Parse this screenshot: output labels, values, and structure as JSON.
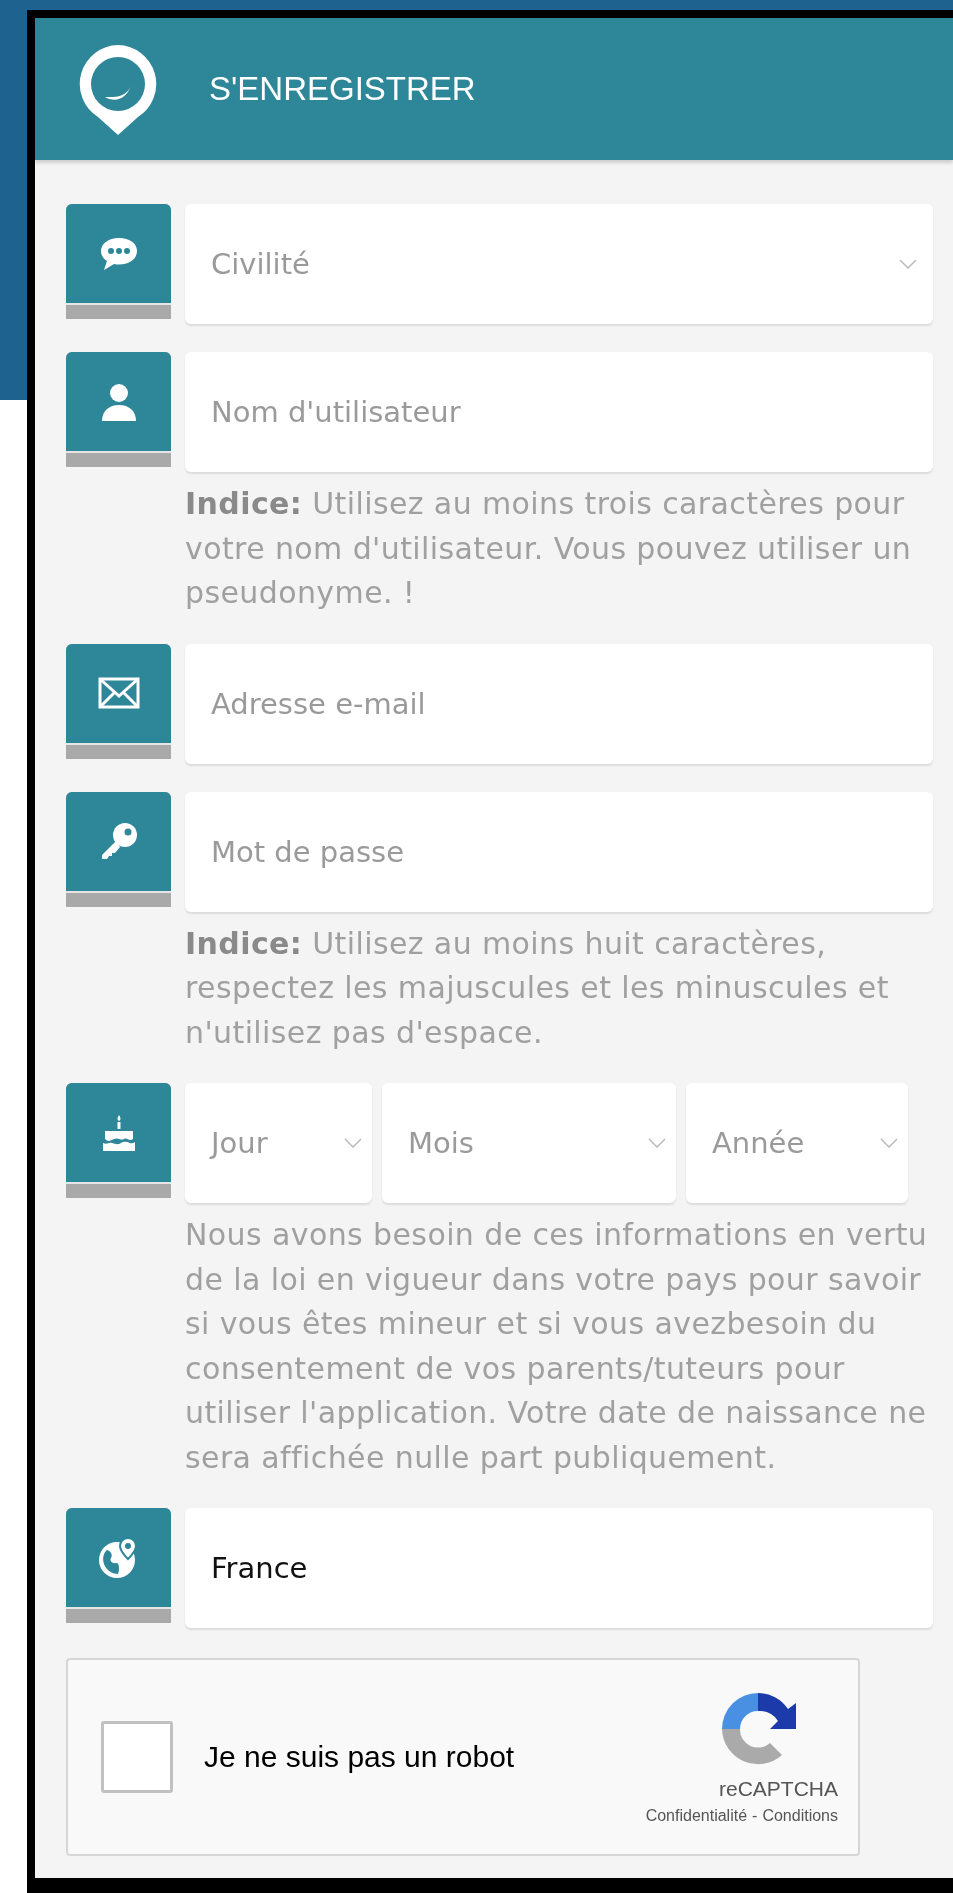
{
  "header": {
    "title": "S'ENREGISTRER"
  },
  "rows": [
    {
      "kind": "select",
      "placeholder": "Civilité"
    },
    {
      "kind": "input",
      "placeholder": "Nom d'utilisateur",
      "hint": "**Indice:** Utilisez au moins trois caractères pour votre nom d'utilisateur. Vous pouvez utiliser un pseudonyme. !"
    },
    {
      "kind": "input",
      "placeholder": "Adresse e-mail"
    },
    {
      "kind": "input",
      "placeholder": "Mot de passe",
      "hint": "**Indice:** Utilisez au moins huit caractères, respectez les majuscules et les minuscules et n'utilisez pas d'espace."
    },
    {
      "kind": "date",
      "parts": [
        {
          "placeholder": "Jour"
        },
        {
          "placeholder": "Mois"
        },
        {
          "placeholder": "Année"
        }
      ],
      "hint": "Nous avons besoin de ces informations en vertu de la loi en vigueur dans votre pays pour savoir si vous êtes mineur et si vous avezbesoin du consentement de vos parents/tuteurs pour utiliser l'application. Votre date de naissance ne sera affichée nulle part publiquement."
    },
    {
      "kind": "input",
      "value": "France"
    }
  ],
  "captcha": {
    "checked": false,
    "label": "Je ne suis pas un robot",
    "brand": "reCAPTCHA",
    "privacy": "Confidentialité",
    "separator": "-",
    "terms": "Conditions"
  }
}
